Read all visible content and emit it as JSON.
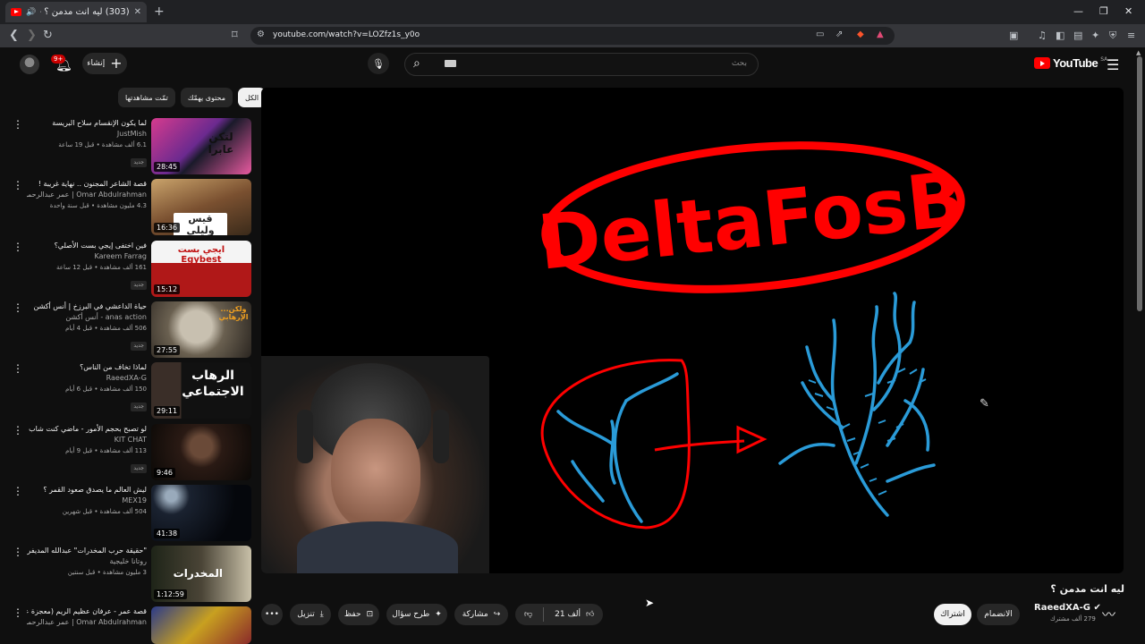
{
  "browser": {
    "tab_title": "(303) ليه انت مدمن ؟ - YouTube",
    "tab_close": "✕",
    "new_tab": "+",
    "url": "youtube.com/watch?v=LOZfz1s_y0o",
    "window_controls": [
      "—",
      "❐",
      "✕"
    ]
  },
  "header": {
    "notification_count": "9+",
    "create_label": "إنشاء",
    "search_placeholder": "بحث",
    "logo_text": "YouTube",
    "logo_region": "SA"
  },
  "chips": [
    "الكل",
    "محتوى يهمّك",
    "تمّت مشاهدتها"
  ],
  "recommendations": [
    {
      "title": "لما يكون الإنقسام سلاح البريسة",
      "channel": "JustMish",
      "stats": "6.1 ألف مشاهدة • قبل 19 ساعة",
      "badge": "جديد",
      "duration": "28:45",
      "thumb_text": "لتكن عابرا"
    },
    {
      "title": "قصة الشاعر المجنون .. نهاية غريبة !",
      "channel": "Omar Abdulrahman | عمر عبدالرحمن",
      "stats": "4.3 مليون مشاهدة • قبل سنة واحدة",
      "badge": "",
      "duration": "16:36",
      "thumb_text": "قيس وليلى"
    },
    {
      "title": "فين اختفى إيجي بست الأصلي؟",
      "channel": "Kareem Farrag",
      "stats": "161 ألف مشاهدة • قبل 12 ساعة",
      "badge": "جديد",
      "duration": "15:12",
      "thumb_text": "ايجي بست Egybest"
    },
    {
      "title": "حياة الداعشي في البرزخ | أنس أكشن",
      "channel": "anas action - أنس أكشن",
      "stats": "506 ألف مشاهدة • قبل 4 أيام",
      "badge": "جديد",
      "duration": "27:55",
      "thumb_text": "ولكن... الإرهابي"
    },
    {
      "title": "لماذا تخاف من الناس؟",
      "channel": "RaeedXA-G",
      "stats": "150 ألف مشاهدة • قبل 6 أيام",
      "badge": "جديد",
      "duration": "29:11",
      "thumb_text": "الرهاب الاجتماعي"
    },
    {
      "title": "لو تصبح بحجم الأمور - ماضي كنت شاب",
      "channel": "KIT CHAT",
      "stats": "113 ألف مشاهدة • قبل 9 أيام",
      "badge": "جديد",
      "duration": "9:46",
      "thumb_text": ""
    },
    {
      "title": "ليش العالم ما يصدق صعود القمر ؟",
      "channel": "MEX19",
      "stats": "504 ألف مشاهدة • قبل شهرين",
      "badge": "",
      "duration": "41:38",
      "thumb_text": ""
    },
    {
      "title": "\"حقيقة حرب المخدرات\" عبدالله المديفر يحاور اللواء في حلقة خاصة استثنائية",
      "channel": "روتانا خليجية",
      "stats": "3 مليون مشاهدة • قبل سنتين",
      "badge": "",
      "duration": "1:12:59",
      "thumb_text": "المخدرات"
    },
    {
      "title": "قصة عمر - عرفان عظيم الريم (معجزة عجيبة)",
      "channel": "Omar Abdulrahman | عمر عبدالرحمن",
      "stats": "",
      "badge": "",
      "duration": "",
      "thumb_text": ""
    }
  ],
  "player": {
    "board_word": "DeltaFosB"
  },
  "video": {
    "title": "ليه انت مدمن ؟",
    "channel_name": "RaeedXA-G",
    "subscribers": "279 ألف مشترك",
    "join_label": "الانضمام",
    "subscribe_label": "اشتراك",
    "like_count": "21 ألف",
    "share_label": "مشاركة",
    "ask_label": "طرح سؤال",
    "save_label": "حفظ",
    "download_label": "تنزيل",
    "more_label": "•••"
  }
}
